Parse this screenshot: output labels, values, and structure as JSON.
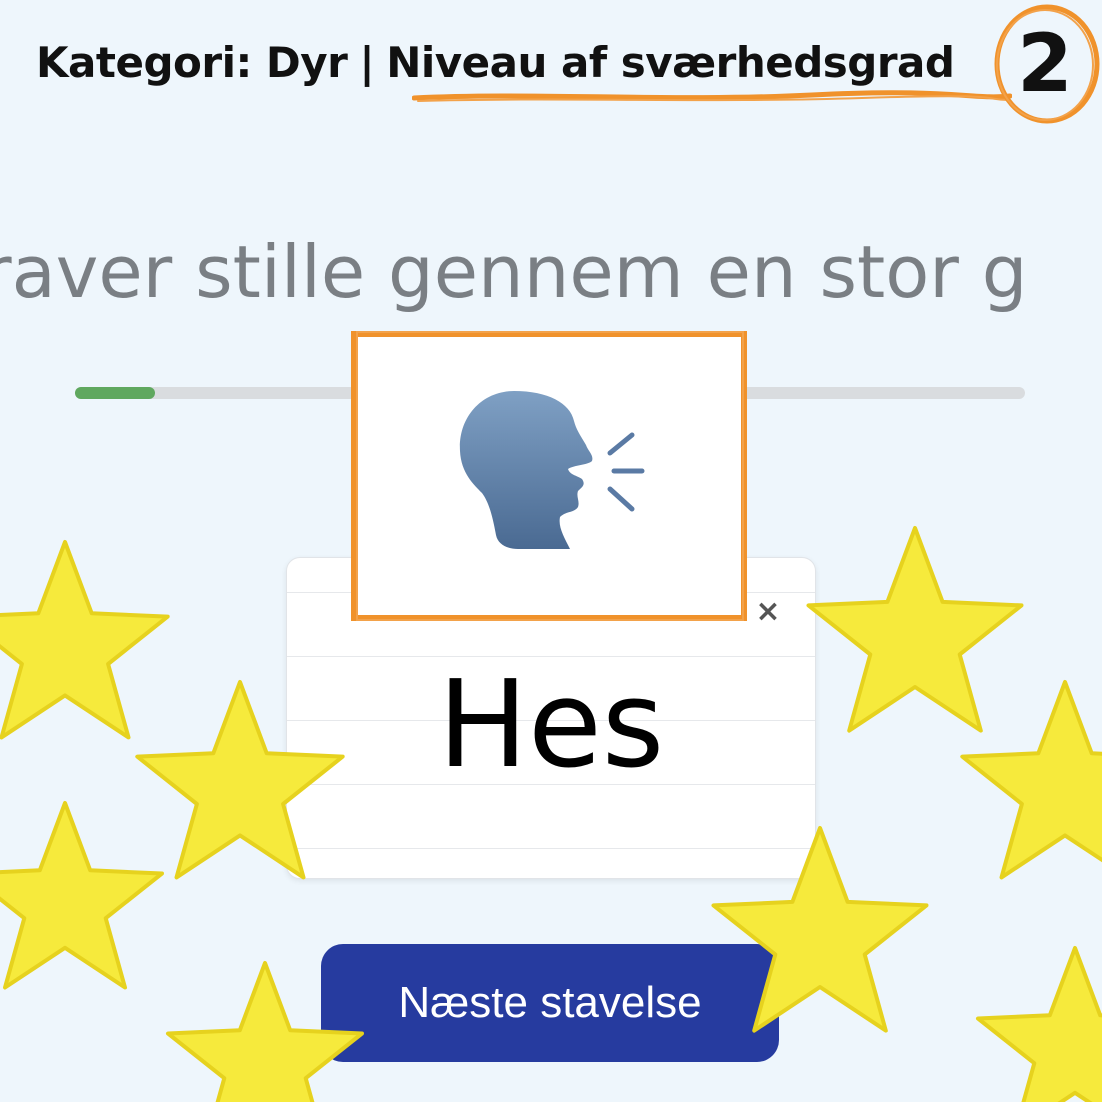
{
  "header": {
    "category_text": "Kategori: Dyr",
    "separator": "|",
    "level_label": "Niveau af sværhedsgrad",
    "level_number": "2"
  },
  "sentence": {
    "text": "raver stille gennem en stor g"
  },
  "progress": {
    "fraction": 0.084
  },
  "speak_button": {
    "icon": "speaking-head-icon"
  },
  "card": {
    "word": "Hes",
    "close_icon": "close-icon",
    "close_label": "×"
  },
  "next_button": {
    "label": "Næste stavelse"
  },
  "colors": {
    "background": "#eef6fc",
    "accent_orange": "#f0922b",
    "button_blue": "#263b9f",
    "progress_green": "#5fa85f",
    "star_yellow": "#f6ea3c"
  },
  "decorations": {
    "stars_icon": "star-icon"
  }
}
